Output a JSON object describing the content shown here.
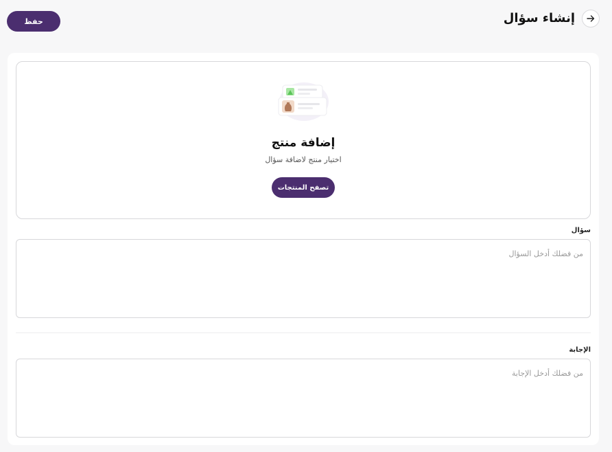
{
  "header": {
    "title": "إنشاء سؤال",
    "save_label": "حفظ",
    "back_icon": "arrow-right-icon"
  },
  "product": {
    "title": "إضافة منتج",
    "subtitle": "اختيار منتج لاضافة سؤال",
    "browse_label": "تصفح المنتجات",
    "illustration_icon": "product-cards-illustration"
  },
  "question": {
    "label": "سؤال",
    "placeholder": "من فضلك أدخل السؤال",
    "value": ""
  },
  "answer": {
    "label": "الإجابة",
    "placeholder": "من فضلك أدخل الإجابة",
    "value": ""
  },
  "colors": {
    "accent": "#4b2e6f",
    "background": "#f7f7f8",
    "border": "#d7d7da"
  }
}
